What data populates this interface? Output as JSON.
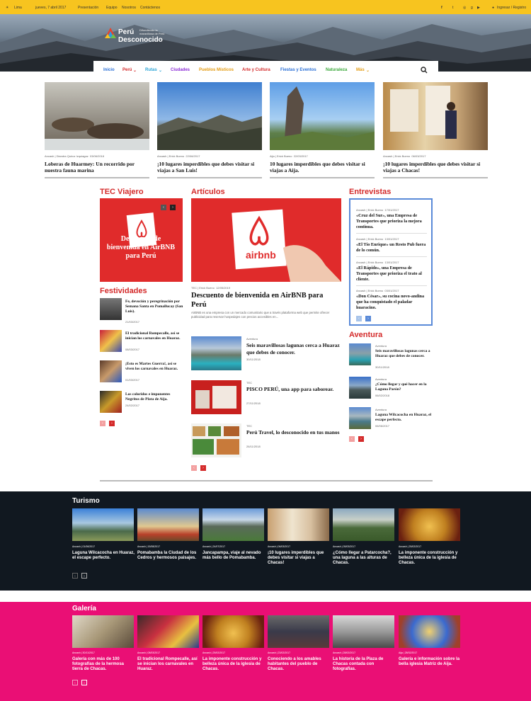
{
  "topbar": {
    "location": "Lima",
    "date": "jueves, 7 abril 2017",
    "links": [
      "Presentación",
      "Equipo",
      "Nosotros",
      "Contáctenos"
    ],
    "login": "Ingresar / Registro"
  },
  "logo": {
    "line1": "Perú",
    "line2": "Desconocido",
    "tagline": "Difundiendo la maravillosa de Perú"
  },
  "nav": [
    "Inicio",
    "Perú",
    "Rutas",
    "Ciudades",
    "Pueblos Místicos",
    "Arte y Cultura",
    "Fiestas y Eventos",
    "Naturaleza",
    "Más"
  ],
  "featured": [
    {
      "cat": "Ancash",
      "author": "Diandra Quiroz Izquiagaz",
      "date": "03/06/2018",
      "title": "Loberas de Huarmey: Un recorrido por nuestra fauna marina"
    },
    {
      "cat": "Ancash",
      "author": "Erick Bueno",
      "date": "22/06/2017",
      "title": "¡10 lugares imperdibles que debes visitar si viajas a San Luis!"
    },
    {
      "cat": "Aija",
      "author": "Erick Bueno",
      "date": "22/03/2017",
      "title": "10 lugares imperdibles que debes visitar si viajas a Aija."
    },
    {
      "cat": "Ancash",
      "author": "Erick Bueno",
      "date": "06/03/2017",
      "title": "¡10 lugares imperdibles que debes visitar si viajas a Chacas!"
    }
  ],
  "tec": {
    "heading": "TEC Viajero",
    "caption": "Descuento de bienvenida en AirBNB para Perú"
  },
  "festividades": {
    "heading": "Festividades",
    "items": [
      {
        "title": "Fe, devoción y peregrinación por Semana Santa en Pomallucay (San Luis).",
        "date": "21/03/2017"
      },
      {
        "title": "El tradicional Rompecalle, así se inician los carnavales en Huaraz.",
        "date": "08/03/2017"
      },
      {
        "title": "¡Esto es Martes Guerra!, así se viven los carnavales en Huaraz.",
        "date": "01/03/2017"
      },
      {
        "title": "Los coloridos e imponentes Negritos de Plata de Aija.",
        "date": "24/02/2017"
      }
    ]
  },
  "articulos": {
    "heading": "Artículos",
    "main": {
      "cat": "TEC",
      "author": "Erick Bueno",
      "date": "12/05/2019",
      "title": "Descuento de bienvenida en AirBNB para Perú",
      "excerpt": "AirBNB es una empresa con un mercado comunitario que a través plataforma web que permite ofrecer publicidad para reservar hospedajes con precios accesibles en...",
      "badge": "airbnb"
    },
    "list": [
      {
        "cat": "Aventura",
        "title": "Seis maravillosas lagunas cerca a Huaraz que debes de conocer.",
        "date": "30/11/2018"
      },
      {
        "cat": "TEC",
        "title": "PISCO PERÚ, una app para saborear.",
        "date": "27/11/2018"
      },
      {
        "cat": "TEC",
        "title": "Perú Travel, lo desconocido en tus manos",
        "date": "26/11/2018"
      }
    ]
  },
  "entrevistas": {
    "heading": "Entrevistas",
    "items": [
      {
        "cat": "Ancash",
        "author": "Erick Bueno",
        "date": "17/01/2017",
        "title": "«Cruz del Sur», una Empresa de Transportes que prioriza la mejora continua."
      },
      {
        "cat": "Ancash",
        "author": "Erick Bueno",
        "date": "13/01/2017",
        "title": "«El Tío Enrique» un Resto Pub fuera de lo común."
      },
      {
        "cat": "Ancash",
        "author": "Erick Bueno",
        "date": "13/01/2017",
        "title": "«El Rápido», una Empresa de Transportes que prioriza el trato al cliente."
      },
      {
        "cat": "Ancash",
        "author": "Erick Bueno",
        "date": "03/01/2017",
        "title": "«Don César», su cocina novo-andina que ha conquistado el paladar huaracino."
      }
    ]
  },
  "aventura": {
    "heading": "Aventura",
    "items": [
      {
        "cat": "Aventura",
        "title": "Seis maravillosas lagunas cerca a Huaraz que debes de conocer.",
        "date": "30/11/2018"
      },
      {
        "cat": "Aventura",
        "title": "¿Cómo llegar y qué hacer en la Laguna Parón?",
        "date": "06/02/2018"
      },
      {
        "cat": "Aventura",
        "title": "Laguna Wilcacocha en Huaraz, el escape perfecto.",
        "date": "06/06/2017"
      }
    ]
  },
  "turismo": {
    "heading": "Turismo",
    "items": [
      {
        "cat": "Ancash",
        "date": "01/06/2017",
        "title": "Laguna Wilcacocha en Huaraz, el escape perfecto."
      },
      {
        "cat": "Ancash",
        "date": "15/08/2017",
        "title": "Pomabamba la Ciudad de los Cedros y hermosos paisajes."
      },
      {
        "cat": "Ancash",
        "date": "24/07/2017",
        "title": "Jancapampa, viaje al nevado más bello de Pomabamba."
      },
      {
        "cat": "Ancash",
        "date": "06/03/2017",
        "title": "¡10 lugares imperdibles que debes visitar si viajas a Chacas!"
      },
      {
        "cat": "Ancash",
        "date": "05/03/2017",
        "title": "¿Cómo llegar a Patarcocha?, una laguna a las alturas de Chacas."
      },
      {
        "cat": "Ancash",
        "date": "25/02/2017",
        "title": "La imponente construcción y belleza única de la iglesia de Chacas."
      }
    ]
  },
  "galeria": {
    "heading": "Galería",
    "items": [
      {
        "cat": "Ancash",
        "date": "30/11/2017",
        "title": "Galería con más de 100 fotografías de la hermosa tierra de Chacas."
      },
      {
        "cat": "Ancash",
        "date": "08/03/2017",
        "title": "El tradicional Rompecalle, así se inician los carnavales en Huaraz."
      },
      {
        "cat": "Ancash",
        "date": "25/02/2017",
        "title": "La imponente construcción y belleza única de la iglesia de Chacas."
      },
      {
        "cat": "Ancash",
        "date": "23/02/2017",
        "title": "Conociendo a los amables habitantes del pueblo de Chacas."
      },
      {
        "cat": "Ancash",
        "date": "28/02/2017",
        "title": "La historia de la Plaza de Chacas contada con fotografías."
      },
      {
        "cat": "Aija",
        "date": "28/02/2017",
        "title": "Galería e información sobre la bella iglesia Matriz de Aija."
      }
    ]
  },
  "colors": {
    "topbar": "#f7c41f",
    "accent": "#d42a2a",
    "dark": "#111820",
    "pink": "#ea0f75"
  }
}
